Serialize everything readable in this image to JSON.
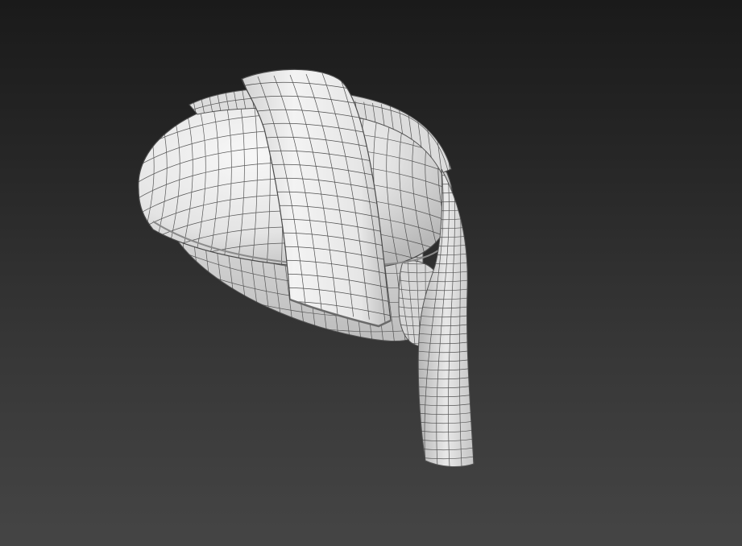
{
  "viewport": {
    "background_top": "#1a1a1a",
    "background_bottom": "#454545",
    "mesh_color": "#e9e9e9",
    "wire_color": "#333333",
    "shading": "smooth-with-wireframe",
    "object": "turban-hat-mesh"
  }
}
